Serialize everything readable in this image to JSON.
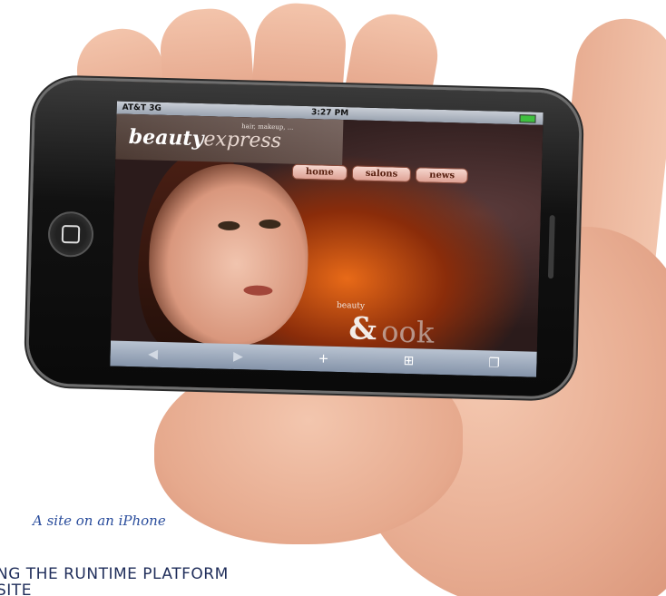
{
  "phone": {
    "status_bar": {
      "carrier": "AT&T 3G",
      "time": "3:27 PM"
    },
    "website": {
      "logo_small": "hair, makeup, ...",
      "logo_bold": "beauty",
      "logo_rest": "express",
      "nav": [
        "home",
        "salons",
        "news"
      ],
      "beauty_tag": "beauty",
      "amp": "&",
      "look": "ook"
    },
    "toolbar": {
      "back_icon": "◀",
      "forward_icon": "▶",
      "add_icon": "+",
      "bookmarks_icon": "⊞",
      "pages_icon": "❐"
    }
  },
  "caption": "A site on an iPhone",
  "heading_line1": "NG THE RUNTIME PLATFORM",
  "heading_line2": "SITE"
}
